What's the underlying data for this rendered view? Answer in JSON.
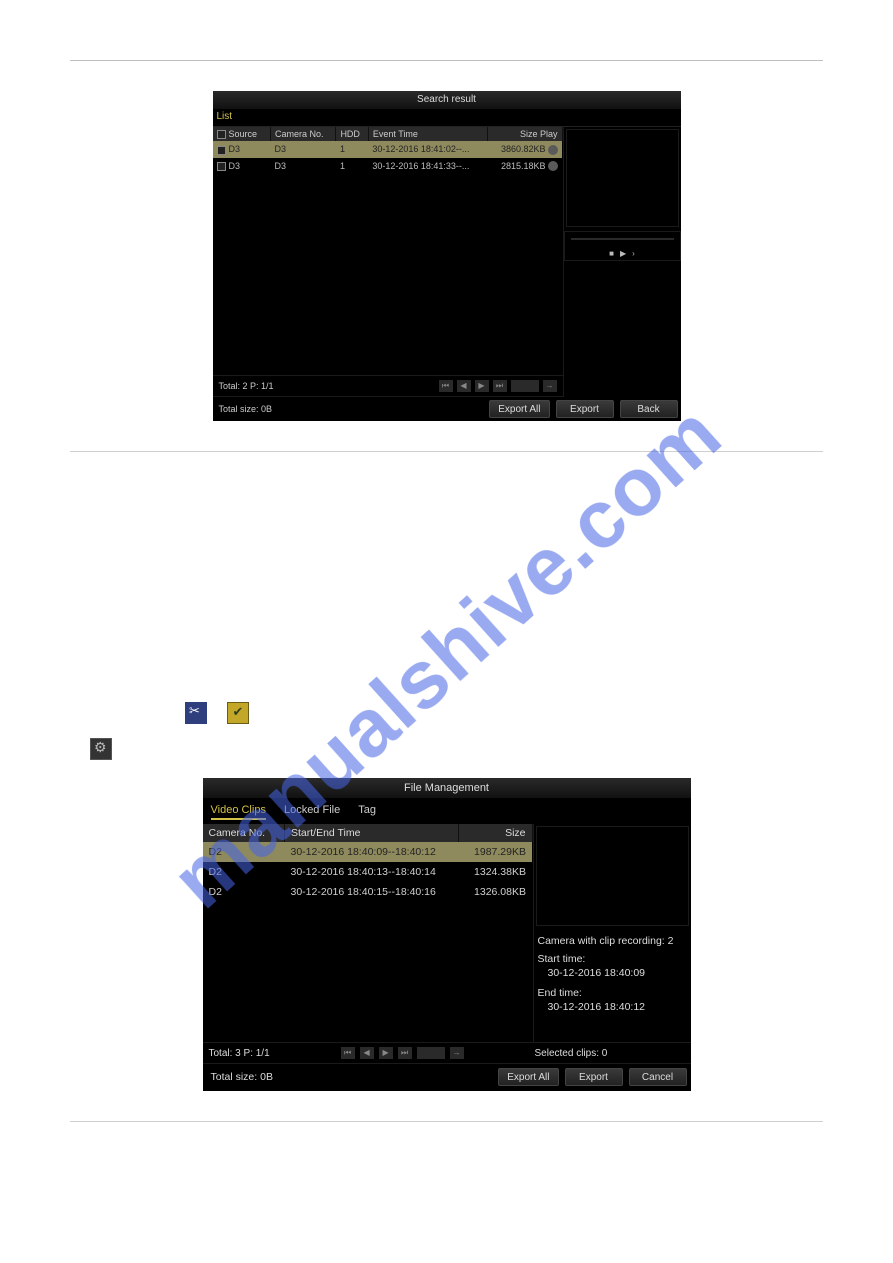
{
  "watermark": "manualshive.com",
  "fig1": {
    "title": "Search result",
    "tab_list": "List",
    "columns": {
      "source": "Source",
      "camera": "Camera No.",
      "hdd": "HDD",
      "event_time": "Event Time",
      "size_play": "Size Play"
    },
    "rows": [
      {
        "source": "D3",
        "camera": "D3",
        "hdd": "1",
        "event": "30-12-2016 18:41:02--...",
        "size": "3860.82KB"
      },
      {
        "source": "D3",
        "camera": "D3",
        "hdd": "1",
        "event": "30-12-2016 18:41:33--...",
        "size": "2815.18KB"
      }
    ],
    "pager": "Total: 2  P: 1/1",
    "total_size": "Total size: 0B",
    "buttons": {
      "export_all": "Export All",
      "export": "Export",
      "back": "Back"
    }
  },
  "icons": {
    "scissors": "start-clipping",
    "check": "stop-clipping",
    "gear": "file-management"
  },
  "fig2": {
    "title": "File Management",
    "tabs": {
      "video_clips": "Video Clips",
      "locked_file": "Locked File",
      "tag": "Tag"
    },
    "columns": {
      "camera": "Camera No.",
      "start_end": "Start/End Time",
      "size": "Size"
    },
    "rows": [
      {
        "camera": "D2",
        "time": "30-12-2016 18:40:09--18:40:12",
        "size": "1987.29KB"
      },
      {
        "camera": "D2",
        "time": "30-12-2016 18:40:13--18:40:14",
        "size": "1324.38KB"
      },
      {
        "camera": "D2",
        "time": "30-12-2016 18:40:15--18:40:16",
        "size": "1326.08KB"
      }
    ],
    "meta": {
      "camera_with_clip": "Camera with clip recording: 2",
      "start_label": "Start time:",
      "start_value": "30-12-2016 18:40:09",
      "end_label": "End time:",
      "end_value": "30-12-2016 18:40:12"
    },
    "pager": "Total: 3  P: 1/1",
    "selected_clips": "Selected clips: 0",
    "total_size": "Total size: 0B",
    "buttons": {
      "export_all": "Export All",
      "export": "Export",
      "cancel": "Cancel"
    }
  }
}
